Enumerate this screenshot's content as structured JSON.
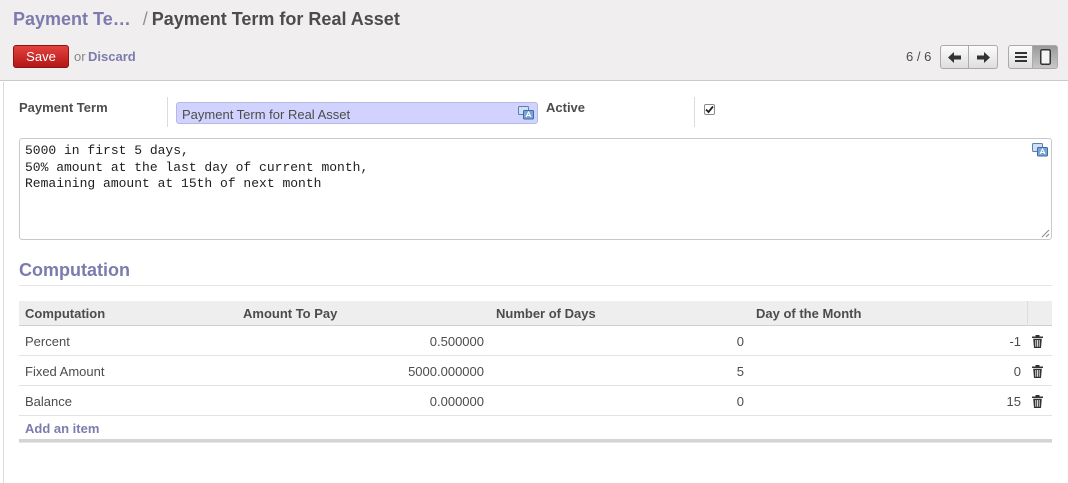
{
  "breadcrumb": {
    "parent": "Payment Te…",
    "separator": "/",
    "current": "Payment Term for Real Asset"
  },
  "toolbar": {
    "save_label": "Save",
    "or_text": "or",
    "discard_label": "Discard"
  },
  "pager": {
    "value": "6 / 6"
  },
  "form": {
    "payment_term_label": "Payment Term",
    "payment_term_value": "Payment Term for Real Asset",
    "active_label": "Active",
    "active_checked": true,
    "note": "5000 in first 5 days,\n50% amount at the last day of current month,\nRemaining amount at 15th of next month"
  },
  "computation": {
    "section_title": "Computation",
    "columns": [
      "Computation",
      "Amount To Pay",
      "Number of Days",
      "Day of the Month"
    ],
    "rows": [
      {
        "computation": "Percent",
        "amount": "0.500000",
        "days": "0",
        "day_of_month": "-1"
      },
      {
        "computation": "Fixed Amount",
        "amount": "5000.000000",
        "days": "5",
        "day_of_month": "0"
      },
      {
        "computation": "Balance",
        "amount": "0.000000",
        "days": "0",
        "day_of_month": "15"
      }
    ],
    "add_item_label": "Add an item"
  },
  "icons": {
    "pager_prev": "arrow-left-icon",
    "pager_next": "arrow-right-icon",
    "view_list": "list-view-icon",
    "view_form": "form-view-icon",
    "translate": "translate-icon",
    "delete": "trash-icon"
  },
  "colors": {
    "brand_purple": "#7c7bad",
    "save_red": "#c42a27",
    "input_highlight": "#d2d2ff"
  }
}
